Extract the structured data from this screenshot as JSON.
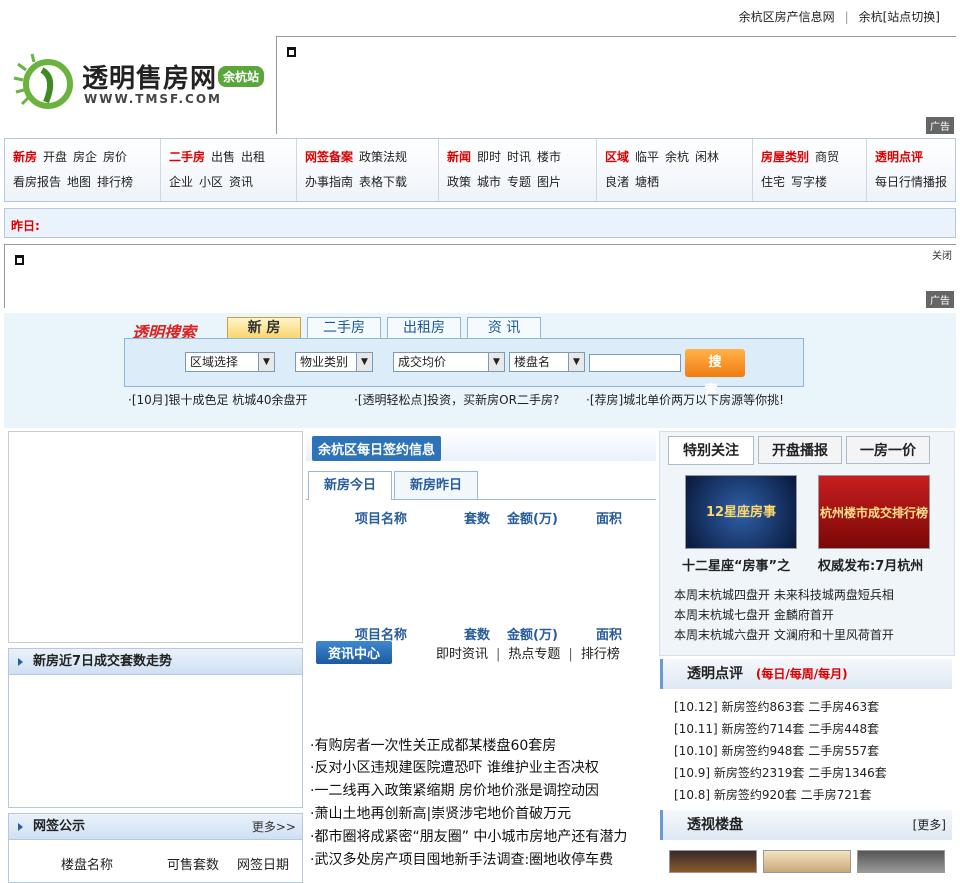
{
  "topbar": {
    "site_info": "余杭区房产信息网",
    "switch": "余杭[站点切换]"
  },
  "logo": {
    "name": "透明售房网",
    "url": "WWW.TMSF.COM",
    "badge": "余杭站"
  },
  "ads": {
    "tag": "广告",
    "close": "关闭"
  },
  "nav": {
    "col1": {
      "row1": [
        "新房",
        "开盘",
        "房企",
        "房价"
      ],
      "row2": [
        "看房报告",
        "地图",
        "排行榜"
      ]
    },
    "col2": {
      "row1": [
        "二手房",
        "出售",
        "出租"
      ],
      "row2": [
        "企业",
        "小区",
        "资讯"
      ]
    },
    "col3": {
      "row1": [
        "网签备案",
        "政策法规"
      ],
      "row2": [
        "办事指南",
        "表格下载"
      ]
    },
    "col4": {
      "row1": [
        "新闻",
        "即时",
        "时讯",
        "楼市"
      ],
      "row2": [
        "政策",
        "城市",
        "专题",
        "图片"
      ]
    },
    "col5": {
      "row1": [
        "区域",
        "临平",
        "余杭",
        "闲林"
      ],
      "row2": [
        "良渚",
        "塘栖"
      ]
    },
    "col6": {
      "row1": [
        "房屋类别",
        "商贸"
      ],
      "row2": [
        "住宅",
        "写字楼"
      ]
    },
    "col7": {
      "row1": [
        "透明点评"
      ],
      "row2": [
        "每日行情播报"
      ]
    }
  },
  "yesterday": {
    "label": "昨日:"
  },
  "search": {
    "title": "透明搜索",
    "tabs": [
      "新 房",
      "二手房",
      "出租房",
      "资 讯"
    ],
    "selects": [
      "区域选择",
      "物业类别",
      "成交均价",
      "楼盘名"
    ],
    "button": "搜 索",
    "headlines": [
      "·[10月]银十成色足 杭城40余盘开",
      "·[透明轻松点]投资，买新房OR二手房?",
      "·[荐房]城北单价两万以下房源等你挑!"
    ]
  },
  "left": {
    "trend_title": "新房近7日成交套数走势",
    "sign_title": "网签公示",
    "sign_more": "更多>>",
    "sign_cols": [
      "楼盘名称",
      "可售套数",
      "网签日期"
    ]
  },
  "middle": {
    "daily_title": "余杭区每日签约信息",
    "tabs": [
      "新房今日",
      "新房昨日"
    ],
    "cols": [
      "项目名称",
      "套数",
      "金额(万)",
      "面积"
    ],
    "info_title": "资讯中心",
    "info_links": [
      "即时资讯",
      "热点专题",
      "排行榜"
    ],
    "news": [
      "·有购房者一次性关正成都某楼盘60套房",
      "·反对小区违规建医院遭恐吓 谁维护业主否决权",
      "·一二线再入政策紧缩期 房价地价涨是调控动因",
      "·萧山土地再创新高|崇贤涉宅地价首破万元",
      "·都市圈将成紧密“朋友圈” 中小城市房地产还有潜力",
      "·武汉多处房产项目囤地新手法调查:圈地收停车费"
    ]
  },
  "right": {
    "tabs": [
      "特别关注",
      "开盘播报",
      "一房一价"
    ],
    "pics": [
      {
        "caption": "十二星座“房事”之",
        "img_text": "12星座房事"
      },
      {
        "caption": "权威发布:7月杭州",
        "img_text": "杭州楼市成交排行榜"
      }
    ],
    "list": [
      "本周末杭城四盘开 未来科技城两盘短兵相",
      "本周末杭城七盘开 金麟府首开",
      "本周末杭城六盘开 文澜府和十里风荷首开"
    ],
    "review_title": "透明点评",
    "review_sub": "(每日/每周/每月)",
    "reviews": [
      "[10.12] 新房签约863套 二手房463套",
      "[10.11] 新房签约714套 二手房448套",
      "[10.10] 新房签约948套 二手房557套",
      "[10.9] 新房签约2319套 二手房1346套",
      "[10.8] 新房签约920套 二手房721套"
    ],
    "projects_title": "透视楼盘",
    "projects_more": "[更多]"
  }
}
